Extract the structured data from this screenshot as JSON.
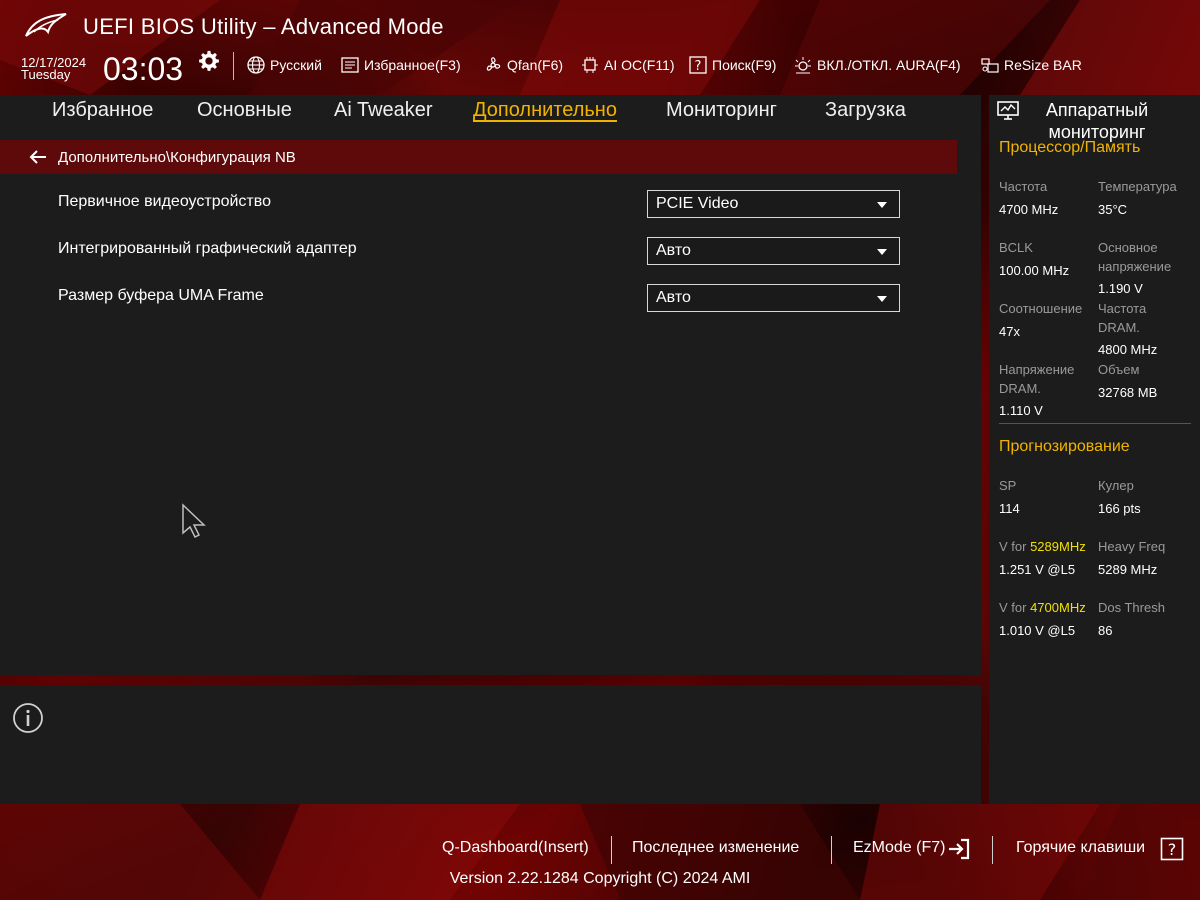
{
  "header": {
    "title": "UEFI BIOS Utility – Advanced Mode",
    "date": "12/17/2024",
    "day": "Tuesday",
    "time": "03:03",
    "tools": {
      "language": "Русский",
      "favorites": "Избранное(F3)",
      "qfan": "Qfan(F6)",
      "ai_oc": "AI OC(F11)",
      "search": "Поиск(F9)",
      "aura": "ВКЛ./ОТКЛ. AURA(F4)",
      "resize_bar": "ReSize BAR"
    }
  },
  "tabs": [
    {
      "label": "Избранное"
    },
    {
      "label": "Основные"
    },
    {
      "label": "Ai Tweaker"
    },
    {
      "label": "Дополнительно",
      "active": true
    },
    {
      "label": "Мониторинг"
    },
    {
      "label": "Загрузка"
    }
  ],
  "breadcrumb": "Дополнительно\\Конфигурация NB",
  "settings": [
    {
      "label": "Первичное видеоустройство",
      "value": "PCIE Video"
    },
    {
      "label": "Интегрированный графический адаптер",
      "value": "Авто"
    },
    {
      "label": "Размер буфера UMA Frame",
      "value": "Авто"
    }
  ],
  "hardware_monitor": {
    "title_line1": "Аппаратный",
    "title_line2": "мониторинг",
    "cpu_memory": {
      "section": "Процессор/Память",
      "frequency_label": "Частота",
      "frequency": "4700 MHz",
      "temperature_label": "Температура",
      "temperature": "35°C",
      "bclk_label": "BCLK",
      "bclk": "100.00 MHz",
      "core_voltage_label_1": "Основное",
      "core_voltage_label_2": "напряжение",
      "core_voltage": "1.190 V",
      "ratio_label": "Соотношение",
      "ratio": "47x",
      "dram_freq_label_1": "Частота",
      "dram_freq_label_2": "DRAM.",
      "dram_freq": "4800 MHz",
      "dram_voltage_label_1": "Напряжение",
      "dram_voltage_label_2": "DRAM.",
      "dram_voltage": "1.110 V",
      "capacity_label": "Объем",
      "capacity": "32768 MB"
    },
    "prediction": {
      "section": "Прогнозирование",
      "sp_label": "SP",
      "sp": "114",
      "cooler_label": "Кулер",
      "cooler": "166 pts",
      "v_for_prefix": "V for ",
      "v_for_1_freq": "5289MHz",
      "v_for_1_value": "1.251 V @L5",
      "heavy_freq_label": "Heavy Freq",
      "heavy_freq": "5289 MHz",
      "v_for_2_freq": "4700MHz",
      "v_for_2_value": "1.010 V @L5",
      "dos_thresh_label": "Dos Thresh",
      "dos_thresh": "86"
    }
  },
  "footer": {
    "qdashboard": "Q-Dashboard(Insert)",
    "last_change": "Последнее изменение",
    "ezmode": "EzMode (F7)",
    "hotkeys": "Горячие клавиши",
    "hotkeys_icon": "?",
    "version": "Version 2.22.1284 Copyright (C) 2024 AMI"
  },
  "colors": {
    "accent": "#f0b400",
    "breadcrumb_bg": "#5e0a0a",
    "panel_bg": "#1c1c1c",
    "highlight": "#f0e000"
  }
}
